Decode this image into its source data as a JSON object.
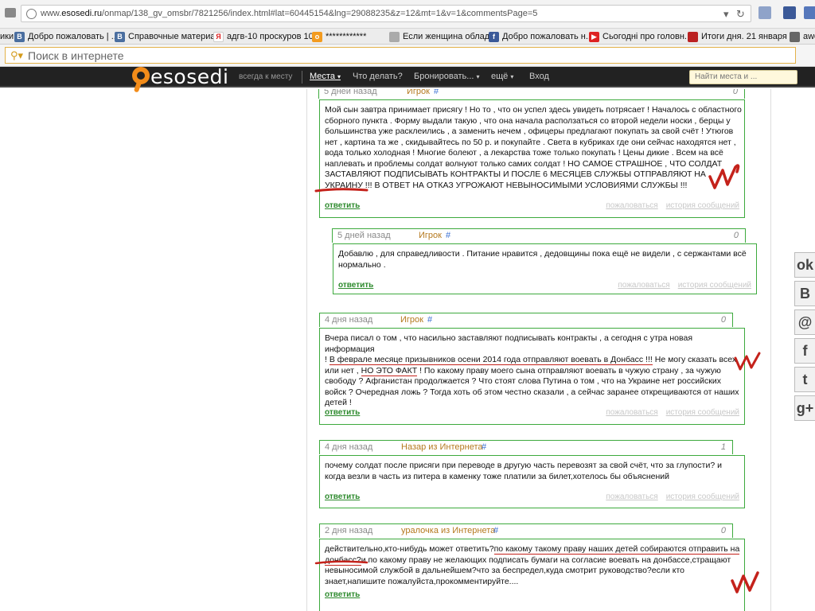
{
  "browser": {
    "url_prefix": "www.",
    "url_domain": "esosedi.ru",
    "url_path": "/onmap/138_gv_omsbr/7821256/index.html#lat=60445154&lng=29088235&z=12&mt=1&v=1&commentsPage=5",
    "bookmarks": [
      {
        "label": "ики",
        "icon": "none"
      },
      {
        "label": "Добро пожаловать | ...",
        "icon": "vk-icon"
      },
      {
        "label": "Справочные материа...",
        "icon": "vk-icon"
      },
      {
        "label": "адгв-10 проскуров 10 ...",
        "icon": "yandex-icon"
      },
      {
        "label": "************",
        "icon": "odnoklassniki-icon"
      },
      {
        "label": "Если женщина облад...",
        "icon": "generic-icon"
      },
      {
        "label": "Добро пожаловать н...",
        "icon": "facebook-icon"
      },
      {
        "label": "Сьогодні про головн...",
        "icon": "youtube-icon"
      },
      {
        "label": "Итоги дня. 21 января |...",
        "icon": "news-icon"
      },
      {
        "label": "awo",
        "icon": "generic-icon"
      }
    ],
    "search_placeholder": "Поиск в интернете"
  },
  "site": {
    "logo": "esosedi",
    "tagline": "всегда к месту",
    "nav": [
      "Места",
      "Что делать?",
      "Бронировать...",
      "ещё",
      "Вход"
    ],
    "search_placeholder": "Найти места и ..."
  },
  "comments": [
    {
      "date": "5 дней назад",
      "author": "Игрок",
      "hash": "#",
      "score": "0",
      "lines": [
        [
          {
            "t": "Мой сын завтра принимает присягу ! Но то , что он успел здесь увидеть потрясает ! Началось с областного"
          }
        ],
        [
          {
            "t": "сборного пункта . Форму выдали такую , что она начала расползаться со второй недели носки , берцы у"
          }
        ],
        [
          {
            "t": "большинства уже расклеились , а заменить нечем , офицеры предлагают покупать за свой счёт ! Утюгов"
          }
        ],
        [
          {
            "t": "нет , картина та же , скидывайтесь по 50 р. и покупайте . Света в кубриках где они сейчас находятся нет ,"
          }
        ],
        [
          {
            "t": "вода только холодная ! Многие болеют , а лекарства тоже только покупать ! Цены дикие . Всем на всё"
          }
        ],
        [
          {
            "t": "наплевать и проблемы солдат волнуют только самих солдат ! НО САМОЕ СТРАШНОЕ , ЧТО СОЛДАТ"
          }
        ],
        [
          {
            "t": "ЗАСТАВЛЯЮТ ПОДПИСЫВАТЬ КОНТРАКТЫ И ПОСЛЕ 6 МЕСЯЦЕВ СЛУЖБЫ ОТПРАВЛЯЮТ НА"
          }
        ],
        [
          {
            "t": "УКРАИНУ !!! В ОТВЕТ НА ОТКАЗ УГРОЖАЮТ НЕВЫНОСИМЫМИ УСЛОВИЯМИ СЛУЖБЫ !!!"
          }
        ]
      ],
      "reply": "ответить",
      "complain": "пожаловаться",
      "history": "история сообщений"
    },
    {
      "date": "5 дней назад",
      "author": "Игрок",
      "hash": "#",
      "score": "0",
      "lines": [
        [
          {
            "t": "Добавлю , для справедливости . Питание нравится , дедовщины пока ещё не видели , с сержантами всё"
          }
        ],
        [
          {
            "t": "нормально ."
          }
        ]
      ],
      "reply": "ответить",
      "complain": "пожаловаться",
      "history": "история сообщений"
    },
    {
      "date": "4 дня назад",
      "author": "Игрок",
      "hash": "#",
      "score": "0",
      "lines": [
        [
          {
            "t": "Вчера писал о том , что насильно заставляют подписывать контракты , а сегодня с утра новая информация"
          }
        ],
        [
          {
            "t": "! "
          },
          {
            "t": "В феврале месяце призывников осени 2014 года отправляют воевать в Донбасс !!!",
            "u": true
          },
          {
            "t": " Не могу сказать всех"
          }
        ],
        [
          {
            "t": "или нет , "
          },
          {
            "t": "НО ЭТО ФАКТ",
            "u": true
          },
          {
            "t": " ! По какому праву моего сына отправляют воевать в чужую страну , за чужую"
          }
        ],
        [
          {
            "t": "свободу ? Афганистан продолжается ? Что стоят слова Путина о том , что на Украине нет российских"
          }
        ],
        [
          {
            "t": "войск ? Очередная ложь ? Тогда хоть об этом честно сказали , а сейчас заранее открещиваются от наших"
          }
        ],
        [
          {
            "t": "детей !"
          }
        ]
      ],
      "reply": "ответить",
      "complain": "пожаловаться",
      "history": "история сообщений"
    },
    {
      "date": "4 дня назад",
      "author": "Назар из Интернета",
      "hash": "#",
      "score": "1",
      "lines": [
        [
          {
            "t": "почему солдат после присяги при переводе в другую часть перевозят за свой счёт, что за глупости? и"
          }
        ],
        [
          {
            "t": "когда везли в часть из питера в каменку тоже платили за билет,хотелось бы объяснений"
          }
        ]
      ],
      "reply": "ответить",
      "complain": "пожаловаться",
      "history": "история сообщений"
    },
    {
      "date": "2 дня назад",
      "author": "уралочка из Интернета",
      "hash": "#",
      "score": "0",
      "lines": [
        [
          {
            "t": "действительно,кто-нибудь может ответить?"
          },
          {
            "t": "по какому такому праву наших детей собираются отправить на",
            "u": true
          }
        ],
        [
          {
            "t": "донбасс?",
            "u": true
          },
          {
            "t": "и по какому праву не желающих подписать бумаги на согласие воевать на донбассе,стращают"
          }
        ],
        [
          {
            "t": "невыносимой службой в дальнейшем?что за беспредел,куда смотрит руководство?если кто"
          }
        ],
        [
          {
            "t": "знает,напишите пожалуйста,прокомментируйте...."
          }
        ]
      ],
      "reply": "ответить",
      "complain": "пожаловаться",
      "history": "история сообщений"
    }
  ],
  "share_icons": [
    "odnoklassniki-icon",
    "vk-icon",
    "mail-icon",
    "facebook-icon",
    "twitter-icon",
    "google-plus-icon"
  ],
  "colors": {
    "accent_green": "#3daa3d",
    "author": "#b5791f",
    "annotation_red": "#c4221b",
    "logo_orange": "#f28c1a"
  }
}
